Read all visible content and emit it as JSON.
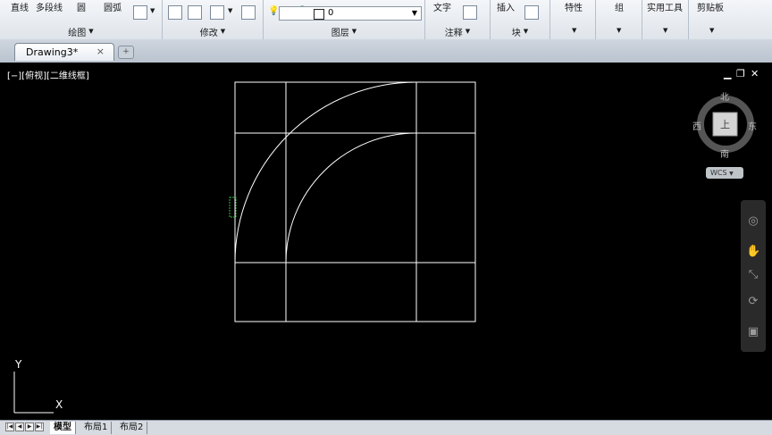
{
  "ribbon": {
    "draw_line": "直线",
    "draw_polyline": "多段线",
    "draw_circle": "圆",
    "draw_arc": "圆弧",
    "panel_draw": "绘图",
    "panel_modify": "修改",
    "panel_layers": "图层",
    "panel_annotation": "注释",
    "panel_block": "块",
    "text_tool": "文字",
    "insert_tool": "插入",
    "properties_tool": "特性",
    "group_tool": "组",
    "utilities_tool": "实用工具",
    "clipboard_tool": "剪贴板",
    "layer_current": "0"
  },
  "tabs": {
    "document": "Drawing3*",
    "close": "×"
  },
  "viewport": {
    "label": "[−][俯视][二维线框]",
    "min": "▁",
    "restore": "❐",
    "close": "✕"
  },
  "viewcube": {
    "north": "北",
    "south": "南",
    "east": "东",
    "west": "西",
    "face": "上",
    "wcs": "WCS"
  },
  "ucs": {
    "x": "X",
    "y": "Y"
  },
  "layout_tabs": [
    "模型",
    "布局1",
    "布局2"
  ],
  "colors": {
    "canvas": "#000000",
    "geometry": "#ffffff",
    "grip": "#2fbf3a",
    "compass": "#555555"
  }
}
